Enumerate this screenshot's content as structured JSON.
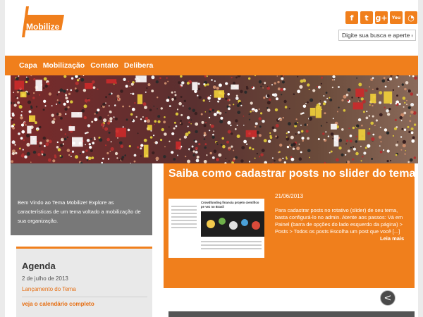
{
  "site": {
    "logo_text": "Mobilize"
  },
  "social": {
    "icons": [
      {
        "name": "facebook-icon",
        "glyph": "f"
      },
      {
        "name": "twitter-icon",
        "glyph": "t"
      },
      {
        "name": "google-plus-icon",
        "glyph": "g+"
      },
      {
        "name": "youtube-icon",
        "glyph": "You"
      },
      {
        "name": "rss-icon",
        "glyph": "◔"
      }
    ]
  },
  "search": {
    "placeholder": "Digite sua busca e aperte enter"
  },
  "nav": {
    "items": [
      "Capa",
      "Mobilização",
      "Contato",
      "Delibera"
    ]
  },
  "welcome": {
    "text": "Bem Vindo ao Tema Mobilize! Explore as características de um tema voltado a mobilização de sua organização."
  },
  "slider": {
    "title": "Saiba como cadastrar posts no slider do tema",
    "date": "21/06/2013",
    "excerpt": "Para cadastrar posts no rotativo (slider) de seu tema, basta configurá-lo no admin.   Atente aos passos: Vá em Painel (barra de opções do lado esquerdo da página) > Posts > Todos os posts Escolha um post que você [...]",
    "read_more": "Leia mais",
    "thumb_title": "Crowdfunding financia projeto científico pe vez no Brasil"
  },
  "agenda": {
    "title": "Agenda",
    "date": "2 de julho de 2013",
    "event": "Lançamento do Tema",
    "calendar_link": "veja o calendário completo"
  },
  "colors": {
    "accent": "#f07f1c",
    "panel": "#787878",
    "background": "#ebebeb"
  }
}
